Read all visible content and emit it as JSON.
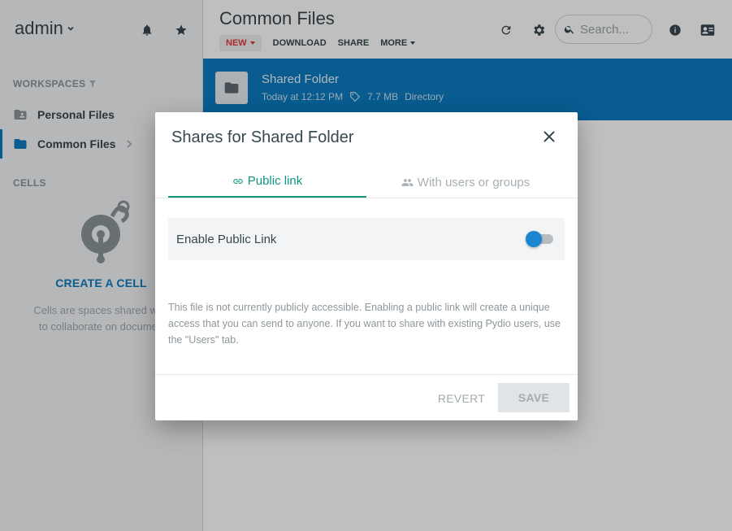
{
  "sidebar": {
    "user": "admin",
    "workspaces_title": "WORKSPACES",
    "workspaces": [
      {
        "label": "Personal Files"
      },
      {
        "label": "Common Files"
      }
    ],
    "cells_title": "CELLS",
    "create_cell": "CREATE A CELL",
    "cells_desc_line1": "Cells are spaces shared with",
    "cells_desc_line2": "to collaborate on documen"
  },
  "main": {
    "title": "Common Files",
    "toolbar": {
      "new": "NEW",
      "download": "DOWNLOAD",
      "share": "SHARE",
      "more": "MORE"
    },
    "search_placeholder": "Search...",
    "selected_row": {
      "name": "Shared Folder",
      "modified": "Today at 12:12 PM",
      "size": "7.7 MB",
      "type": "Directory"
    }
  },
  "dialog": {
    "title": "Shares for Shared Folder",
    "tabs": [
      {
        "label": "Public link"
      },
      {
        "label": "With users or groups"
      }
    ],
    "toggle_label": "Enable Public Link",
    "toggle_enabled": false,
    "help_text": "This file is not currently publicly accessible. Enabling a public link will create a unique access that you can send to anyone. If you want to share with existing Pydio users, use the \"Users\" tab.",
    "revert": "REVERT",
    "save": "SAVE"
  },
  "colors": {
    "accent_blue": "#0b7bc0",
    "accent_teal": "#0f9680",
    "new_red": "#e53935"
  }
}
